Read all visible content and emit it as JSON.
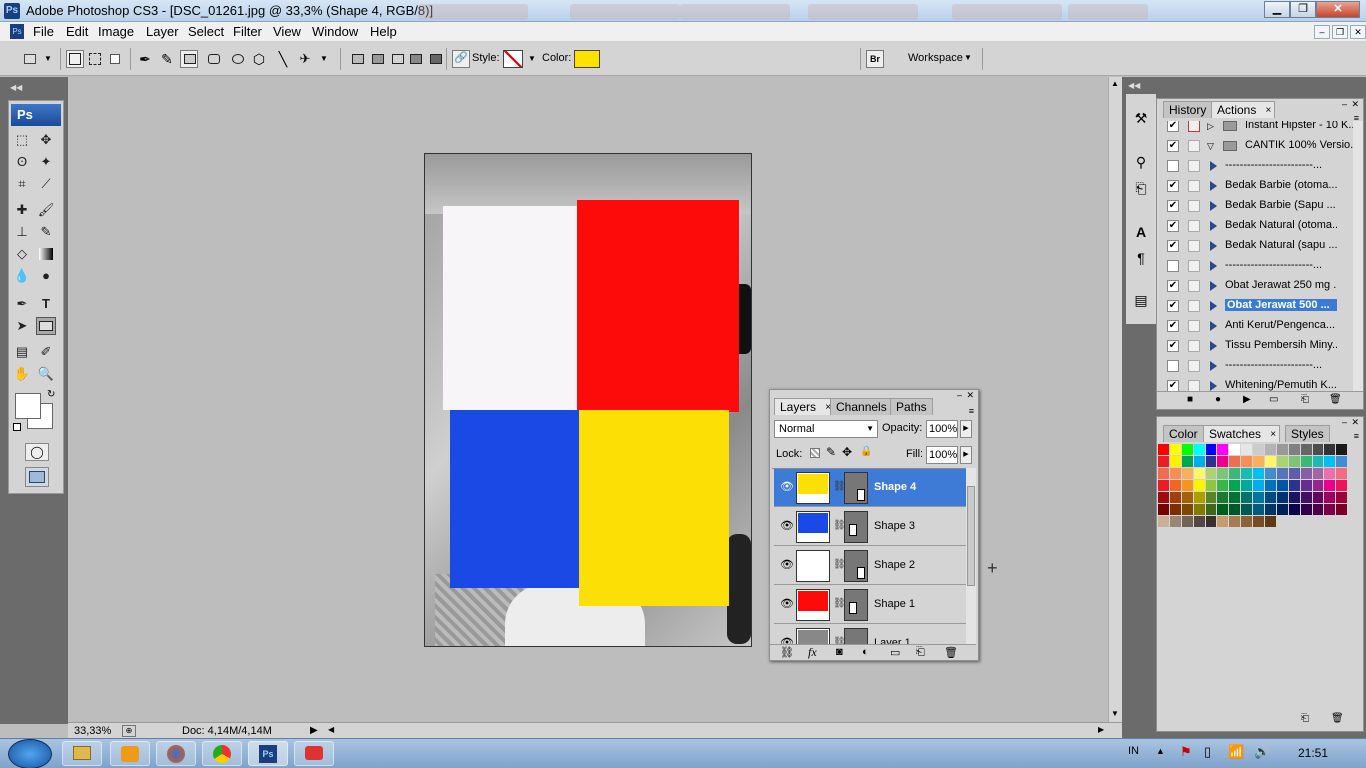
{
  "window": {
    "title": "Adobe Photoshop CS3 - [DSC_01261.jpg @ 33,3% (Shape 4, RGB/8)]",
    "app_icon_text": "Ps"
  },
  "menu": [
    {
      "label": "File",
      "key": "File"
    },
    {
      "label": "Edit",
      "key": "Edit"
    },
    {
      "label": "Image",
      "key": "Image"
    },
    {
      "label": "Layer",
      "key": "Layer"
    },
    {
      "label": "Select",
      "key": "Select"
    },
    {
      "label": "Filter",
      "key": "Filter"
    },
    {
      "label": "View",
      "key": "View"
    },
    {
      "label": "Window",
      "key": "Window"
    },
    {
      "label": "Help",
      "key": "Help"
    }
  ],
  "options": {
    "style_label": "Style:",
    "color_label": "Color:",
    "color_value": "#fde200",
    "workspace_label": "Workspace"
  },
  "toolbox": {
    "logo": "Ps",
    "foreground_color": "#ffffff",
    "background_color": "#ffffff"
  },
  "document": {
    "shapes": [
      {
        "name": "Shape 2",
        "color": "#f7f5f7"
      },
      {
        "name": "Shape 1",
        "color": "#fd0a0a"
      },
      {
        "name": "Shape 3",
        "color": "#1a49e6"
      },
      {
        "name": "Shape 4",
        "color": "#fbdf05"
      }
    ]
  },
  "status": {
    "zoom": "33,33%",
    "doc_info": "Doc: 4,14M/4,14M"
  },
  "history_panel": {
    "tabs": [
      "History",
      "Actions"
    ],
    "active_tab": "Actions",
    "rows": [
      {
        "checked": true,
        "label": "Instant Hipster - 10 K...",
        "folder": true,
        "open": false,
        "red": true
      },
      {
        "checked": true,
        "label": "CANTIK 100% Versio...",
        "folder": true,
        "open": true
      },
      {
        "checked": false,
        "label": "------------------------..."
      },
      {
        "checked": true,
        "label": "Bedak Barbie  (otoma..."
      },
      {
        "checked": true,
        "label": "Bedak Barbie  (Sapu ..."
      },
      {
        "checked": true,
        "label": "Bedak Natural (otoma..."
      },
      {
        "checked": true,
        "label": "Bedak Natural (sapu ..."
      },
      {
        "checked": false,
        "label": "------------------------..."
      },
      {
        "checked": true,
        "label": "Obat Jerawat 250 mg ..."
      },
      {
        "checked": true,
        "label": "Obat Jerawat 500 ...",
        "highlight": true
      },
      {
        "checked": true,
        "label": "Anti Kerut/Pengenca..."
      },
      {
        "checked": true,
        "label": "Tissu Pembersih Miny..."
      },
      {
        "checked": false,
        "label": "------------------------..."
      },
      {
        "checked": true,
        "label": "Whitening/Pemutih K..."
      }
    ]
  },
  "layers_panel": {
    "tabs": [
      "Layers",
      "Channels",
      "Paths"
    ],
    "active_tab": "Layers",
    "blend_mode": "Normal",
    "opacity_label": "Opacity:",
    "opacity_value": "100%",
    "lock_label": "Lock:",
    "fill_label": "Fill:",
    "fill_value": "100%",
    "layers": [
      {
        "name": "Shape 4",
        "color": "#fbdf05",
        "active": true
      },
      {
        "name": "Shape 3",
        "color": "#1a49e6",
        "active": false
      },
      {
        "name": "Shape 2",
        "color": "#ffffff",
        "active": false
      },
      {
        "name": "Shape 1",
        "color": "#fd0a0a",
        "active": false
      },
      {
        "name": "Layer 1",
        "color": "#888888",
        "active": false
      }
    ]
  },
  "color_panel": {
    "tabs": [
      "Color",
      "Swatches",
      "Styles"
    ],
    "active_tab": "Swatches"
  },
  "taskbar": {
    "language": "IN",
    "time": "21:51"
  }
}
